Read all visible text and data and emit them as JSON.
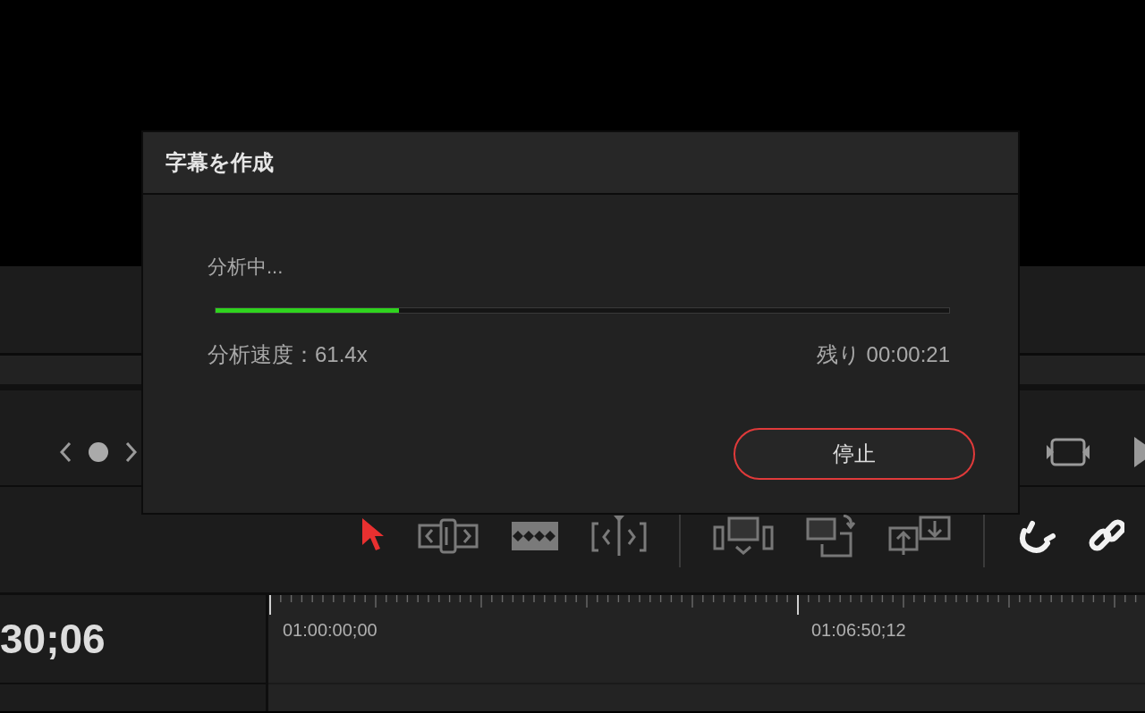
{
  "transport": {
    "controls": [
      {
        "kind": "prev"
      },
      {
        "kind": "dot"
      },
      {
        "kind": "next"
      }
    ],
    "right_controls": [
      {
        "kind": "fit"
      },
      {
        "kind": "play"
      }
    ]
  },
  "toolbar": {
    "tools": [
      {
        "kind": "select",
        "selected": true
      },
      {
        "kind": "trim",
        "selected": false
      },
      {
        "kind": "blade",
        "selected": false
      },
      {
        "kind": "dynamic",
        "selected": false
      }
    ],
    "edits": [
      {
        "kind": "insert"
      },
      {
        "kind": "replace"
      },
      {
        "kind": "swap"
      }
    ],
    "toggles": [
      {
        "kind": "snap",
        "on": true
      },
      {
        "kind": "link",
        "on": true
      }
    ]
  },
  "timeline": {
    "timecode": "30;06",
    "ruler_labels": [
      "01:00:00;00",
      "01:06:50;12"
    ]
  },
  "dialog": {
    "title": "字幕を作成",
    "status": "分析中...",
    "progress": {
      "level": 0.25
    },
    "speed": "分析速度：61.4x",
    "remaining": "残り 00:00:21",
    "buttons": [
      {
        "label": "停止",
        "kind": "stop"
      }
    ]
  }
}
